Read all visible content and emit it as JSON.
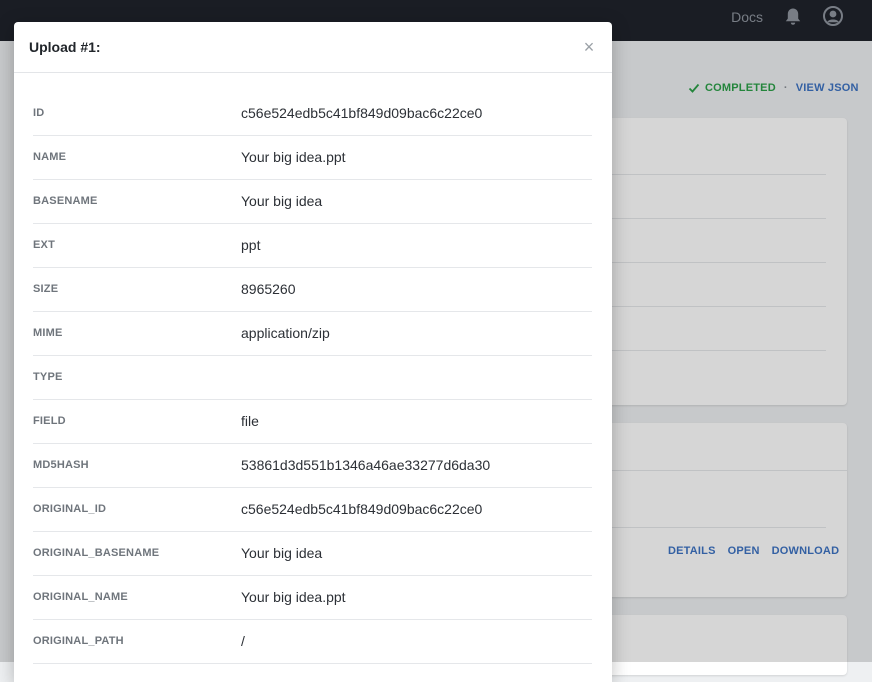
{
  "topbar": {
    "docs_label": "Docs",
    "icons": [
      "bell-icon",
      "user-icon"
    ]
  },
  "background": {
    "status_label": "COMPLETED",
    "separator": "·",
    "view_json_label": "VIEW JSON",
    "links": [
      "DETAILS",
      "OPEN",
      "DOWNLOAD"
    ]
  },
  "modal": {
    "title": "Upload #1:",
    "close_glyph": "×",
    "fields": [
      {
        "key": "ID",
        "value": "c56e524edb5c41bf849d09bac6c22ce0"
      },
      {
        "key": "NAME",
        "value": "Your big idea.ppt"
      },
      {
        "key": "BASENAME",
        "value": "Your big idea"
      },
      {
        "key": "EXT",
        "value": "ppt"
      },
      {
        "key": "SIZE",
        "value": "8965260"
      },
      {
        "key": "MIME",
        "value": "application/zip"
      },
      {
        "key": "TYPE",
        "value": ""
      },
      {
        "key": "FIELD",
        "value": "file"
      },
      {
        "key": "MD5HASH",
        "value": "53861d3d551b1346a46ae33277d6da30"
      },
      {
        "key": "ORIGINAL_ID",
        "value": "c56e524edb5c41bf849d09bac6c22ce0"
      },
      {
        "key": "ORIGINAL_BASENAME",
        "value": "Your big idea"
      },
      {
        "key": "ORIGINAL_NAME",
        "value": "Your big idea.ppt"
      },
      {
        "key": "ORIGINAL_PATH",
        "value": "/"
      }
    ]
  },
  "colors": {
    "topbar": "#1f232b",
    "completed": "#2b9f48",
    "link": "#3d73c3"
  }
}
